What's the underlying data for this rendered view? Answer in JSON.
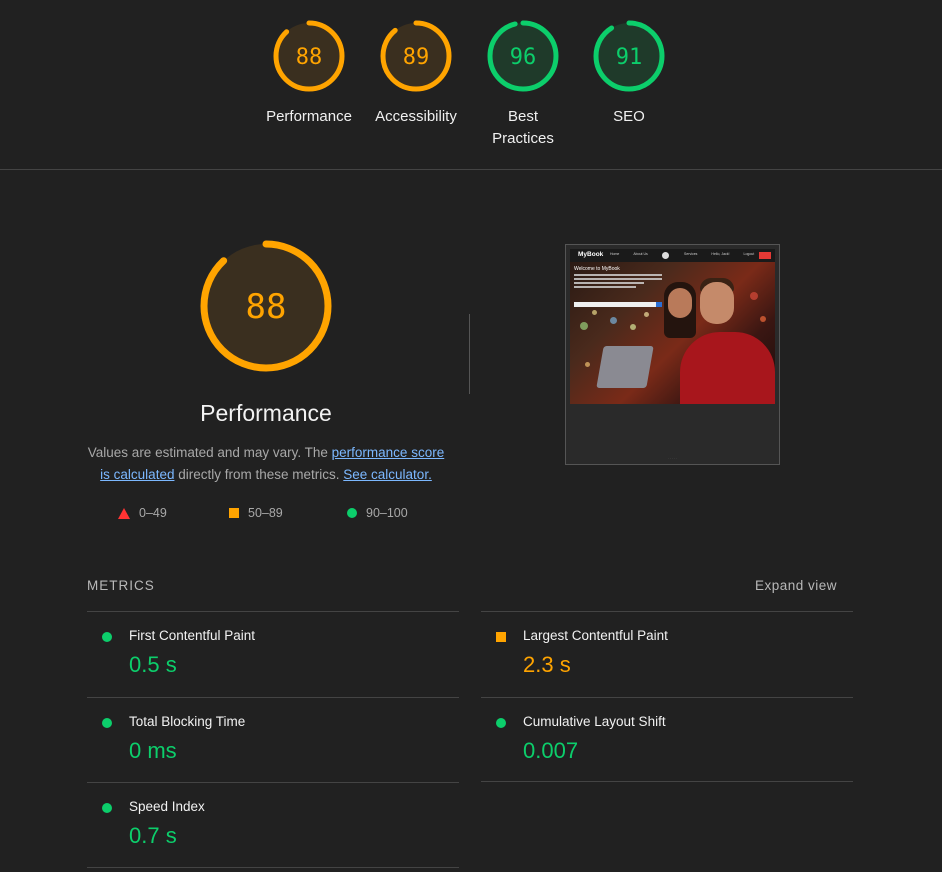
{
  "colors": {
    "pass": "#0cce6b",
    "average": "#ffa400",
    "fail": "#ff3333",
    "pass_bg": "#1f3a2a",
    "average_bg": "#3a2f1f"
  },
  "categories": [
    {
      "label": "Performance",
      "score": 88,
      "rating": "average"
    },
    {
      "label": "Accessibility",
      "score": 89,
      "rating": "average"
    },
    {
      "label": "Best Practices",
      "label_line1": "Best",
      "label_line2": "Practices",
      "score": 96,
      "rating": "pass"
    },
    {
      "label": "SEO",
      "score": 91,
      "rating": "pass"
    }
  ],
  "performance": {
    "score": 88,
    "title": "Performance",
    "desc_prefix": "Values are estimated and may vary. The ",
    "link_score": "performance score is calculated",
    "desc_middle": " directly from these metrics. ",
    "link_calc": "See calculator.",
    "legend": [
      {
        "icon": "fail-triangle-icon",
        "range": "0–49"
      },
      {
        "icon": "average-square-icon",
        "range": "50–89"
      },
      {
        "icon": "pass-circle-icon",
        "range": "90–100"
      }
    ]
  },
  "thumbnail": {
    "logo": "MyBook",
    "nav": [
      "Home",
      "About Us",
      "Services",
      "Hello, Jack!",
      "Logout"
    ],
    "welcome": "Welcome to MyBook"
  },
  "metrics": {
    "header": "METRICS",
    "expand": "Expand view",
    "items": [
      {
        "name": "First Contentful Paint",
        "value": "0.5 s",
        "rating": "pass"
      },
      {
        "name": "Largest Contentful Paint",
        "value": "2.3 s",
        "rating": "average"
      },
      {
        "name": "Total Blocking Time",
        "value": "0 ms",
        "rating": "pass"
      },
      {
        "name": "Cumulative Layout Shift",
        "value": "0.007",
        "rating": "pass"
      },
      {
        "name": "Speed Index",
        "value": "0.7 s",
        "rating": "pass"
      }
    ]
  }
}
